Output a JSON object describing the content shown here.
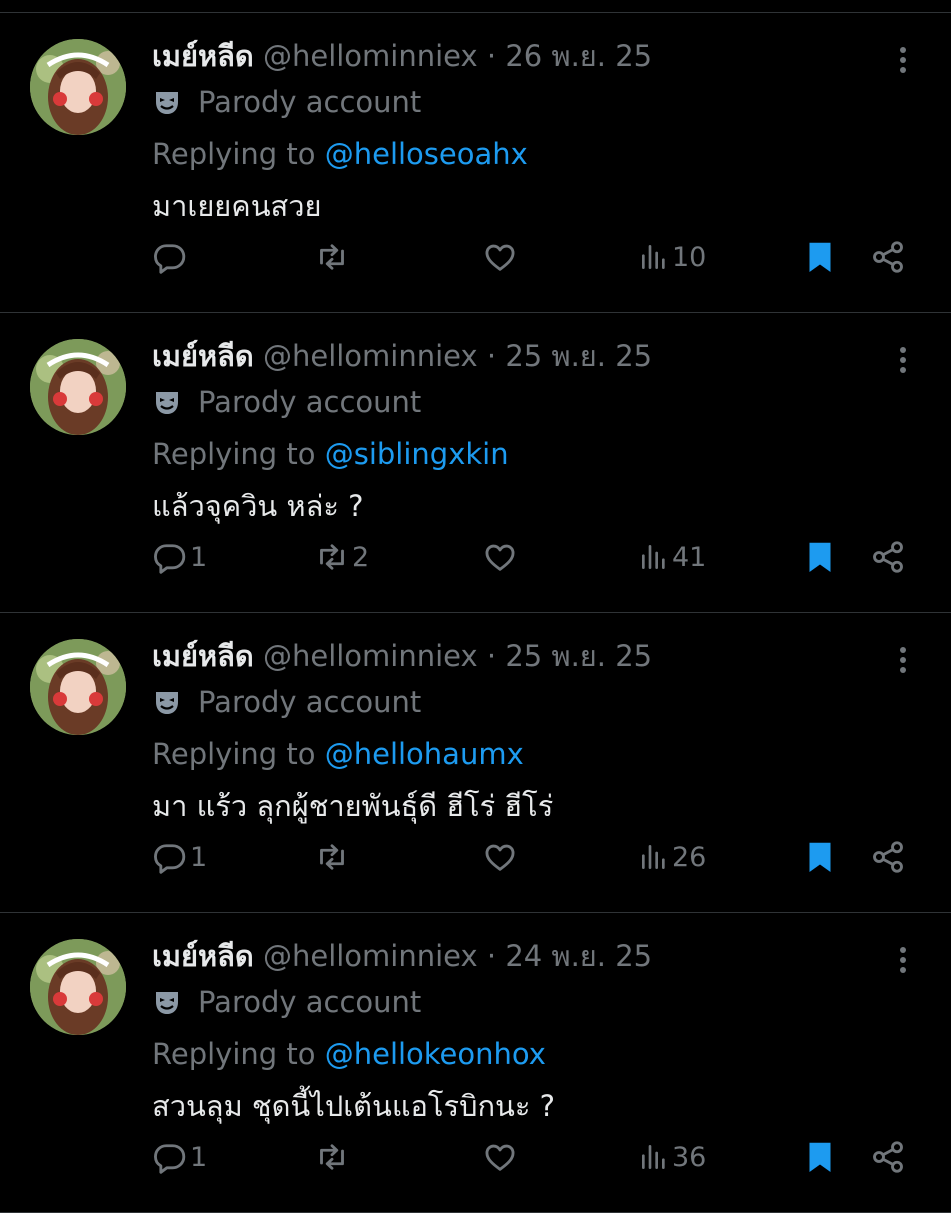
{
  "colors": {
    "background": "#000000",
    "text": "#e7e9ea",
    "muted": "#71767b",
    "accent": "#1d9bf0",
    "divider": "#2f3336"
  },
  "icons": [
    "more-icon",
    "parody-mask-icon",
    "reply-icon",
    "retweet-icon",
    "like-icon",
    "views-icon",
    "bookmark-icon",
    "share-icon"
  ],
  "tweets": [
    {
      "display_name": "เมย์หลีด",
      "handle": "@hellominniex",
      "separator": "·",
      "date": "26 พ.ย. 25",
      "parody_label": "Parody account",
      "reply_prefix": "Replying to",
      "reply_to": "@helloseoahx",
      "text": "มาเยยคนสวย",
      "reply_count": "",
      "retweet_count": "",
      "like_count": "",
      "views": "10",
      "bookmarked": true
    },
    {
      "display_name": "เมย์หลีด",
      "handle": "@hellominniex",
      "separator": "·",
      "date": "25 พ.ย. 25",
      "parody_label": "Parody account",
      "reply_prefix": "Replying to",
      "reply_to": "@siblingxkin",
      "text": "แล้วจุควิน หล่ะ ?",
      "reply_count": "1",
      "retweet_count": "2",
      "like_count": "",
      "views": "41",
      "bookmarked": true
    },
    {
      "display_name": "เมย์หลีด",
      "handle": "@hellominniex",
      "separator": "·",
      "date": "25 พ.ย. 25",
      "parody_label": "Parody account",
      "reply_prefix": "Replying to",
      "reply_to": "@hellohaumx",
      "text": "มา แร้ว ลุกผู้ชายพันธุ์ดี ฮีโร่ ฮีโร่",
      "reply_count": "1",
      "retweet_count": "",
      "like_count": "",
      "views": "26",
      "bookmarked": true
    },
    {
      "display_name": "เมย์หลีด",
      "handle": "@hellominniex",
      "separator": "·",
      "date": "24 พ.ย. 25",
      "parody_label": "Parody account",
      "reply_prefix": "Replying to",
      "reply_to": "@hellokeonhox",
      "text": "สวนลุม ชุดนี้ไปเต้นแอโรบิกนะ ?",
      "reply_count": "1",
      "retweet_count": "",
      "like_count": "",
      "views": "36",
      "bookmarked": true
    }
  ]
}
